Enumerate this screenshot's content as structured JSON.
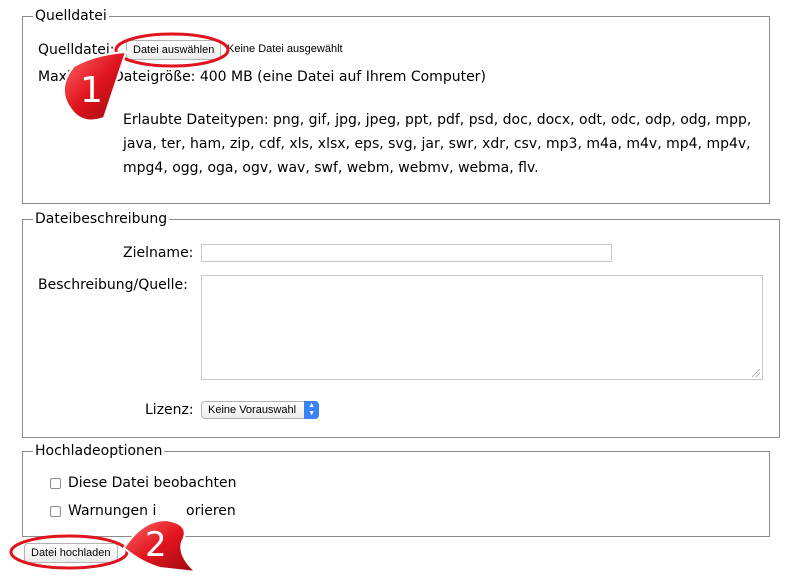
{
  "source": {
    "legend": "Quelldatei",
    "label": "Quelldatei:",
    "choose_button": "Datei auswählen",
    "no_file": "Keine Datei ausgewählt",
    "max_size_prefix": "Maxim",
    "max_size_suffix": "Dateigröße: 400 MB (eine Datei auf Ihrem Computer)",
    "allowed_types": "Erlaubte Dateitypen: png, gif, jpg, jpeg, ppt, pdf, psd, doc, docx, odt, odc, odp, odg, mpp, java, ter, ham, zip, cdf, xls, xlsx, eps, svg, jar, swr, xdr, csv, mp3, m4a, m4v, mp4, mp4v, mpg4, ogg, oga, ogv, wav, swf, webm, webmv, webma, flv."
  },
  "description": {
    "legend": "Dateibeschreibung",
    "target_label": "Zielname:",
    "target_value": "",
    "desc_label": "Beschreibung/Quelle:",
    "desc_value": "",
    "license_label": "Lizenz:",
    "license_selected": "Keine Vorauswahl"
  },
  "options": {
    "legend": "Hochladeoptionen",
    "watch_label": "Diese Datei beobachten",
    "warnings_prefix": "Warnungen i",
    "warnings_suffix": "orieren"
  },
  "upload_button": "Datei hochladen",
  "annotations": {
    "marker_1": "1",
    "marker_2": "2",
    "highlight_color": "#e0141e"
  }
}
